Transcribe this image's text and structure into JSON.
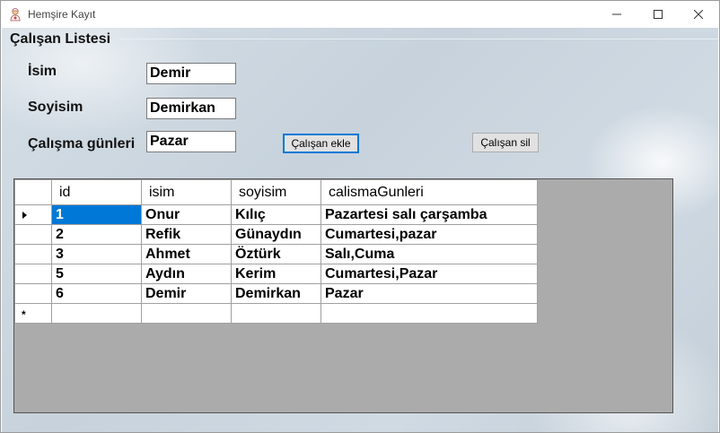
{
  "window": {
    "title": "Hemşire Kayıt"
  },
  "group": {
    "label": "Çalışan Listesi"
  },
  "form": {
    "name_label": "İsim",
    "name_value": "Demir",
    "surname_label": "Soyisim",
    "surname_value": "Demirkan",
    "days_label": "Çalışma günleri",
    "days_value": "Pazar"
  },
  "buttons": {
    "add": "Çalışan ekle",
    "delete": "Çalışan sil"
  },
  "table": {
    "columns": [
      "id",
      "isim",
      "soyisim",
      "calismaGunleri"
    ],
    "rows": [
      [
        "1",
        "Onur",
        "Kılıç",
        "Pazartesi salı çarşamba"
      ],
      [
        "2",
        "Refik",
        "Günaydın",
        "Cumartesi,pazar"
      ],
      [
        "3",
        "Ahmet",
        "Öztürk",
        "Salı,Cuma"
      ],
      [
        "5",
        "Aydın",
        "Kerim",
        "Cumartesi,Pazar"
      ],
      [
        "6",
        "Demir",
        "Demirkan",
        "Pazar"
      ]
    ],
    "new_row_marker": "*"
  },
  "colors": {
    "selection": "#0078d7",
    "grid_background": "#ababab"
  }
}
